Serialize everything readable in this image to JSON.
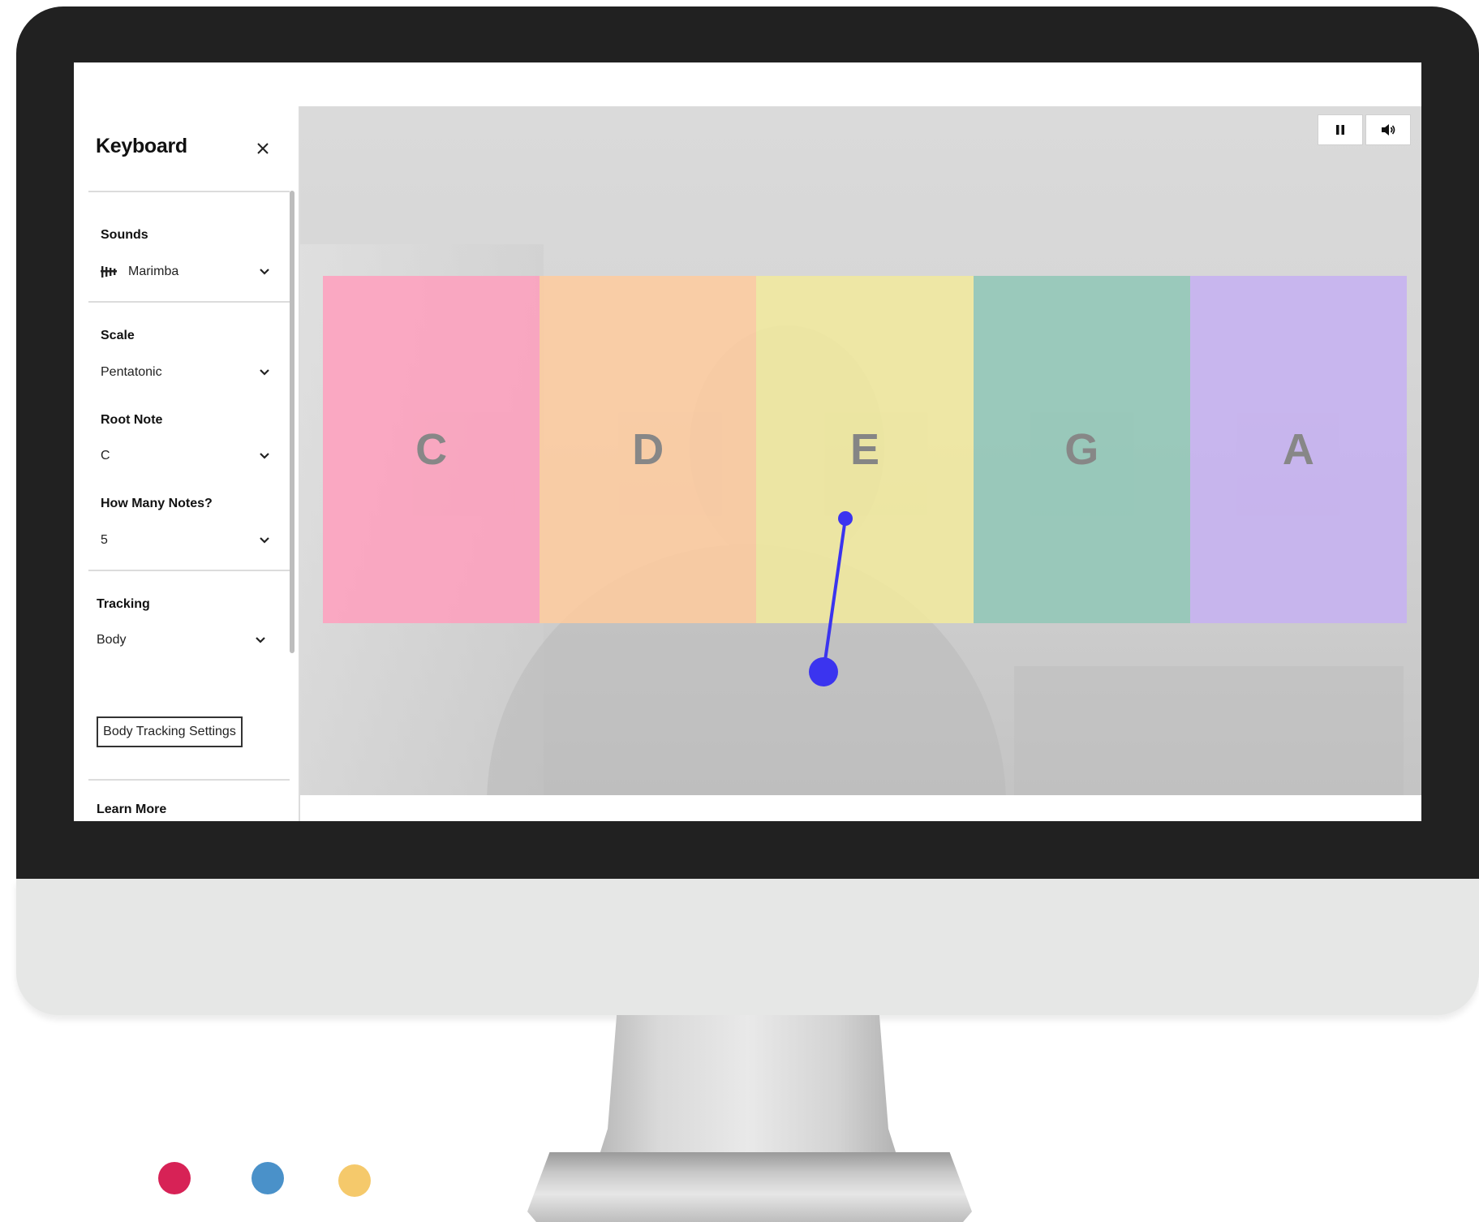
{
  "sidebar": {
    "title": "Keyboard",
    "close_icon": "close-icon",
    "sounds": {
      "label": "Sounds",
      "value": "Marimba",
      "icon": "marimba-icon"
    },
    "scale": {
      "label": "Scale",
      "value": "Pentatonic"
    },
    "root_note": {
      "label": "Root Note",
      "value": "C"
    },
    "note_count": {
      "label": "How Many Notes?",
      "value": "5"
    },
    "tracking": {
      "label": "Tracking",
      "value": "Body",
      "settings_button": "Body Tracking Settings"
    },
    "learn_more": "Learn More"
  },
  "controls": {
    "pause_icon": "pause-icon",
    "volume_icon": "volume-icon"
  },
  "keys": [
    {
      "note": "C",
      "color": "#ff9fbd"
    },
    {
      "note": "D",
      "color": "#ffcb9e"
    },
    {
      "note": "E",
      "color": "#f2ea9c"
    },
    {
      "note": "G",
      "color": "#8fc7b6"
    },
    {
      "note": "A",
      "color": "#c6b0f2"
    }
  ],
  "colors": {
    "monitor_bezel": "#212121",
    "tracker": "#3b34ef",
    "decor_dots": [
      "#d72256",
      "#4a91c9",
      "#f5c96b"
    ]
  }
}
